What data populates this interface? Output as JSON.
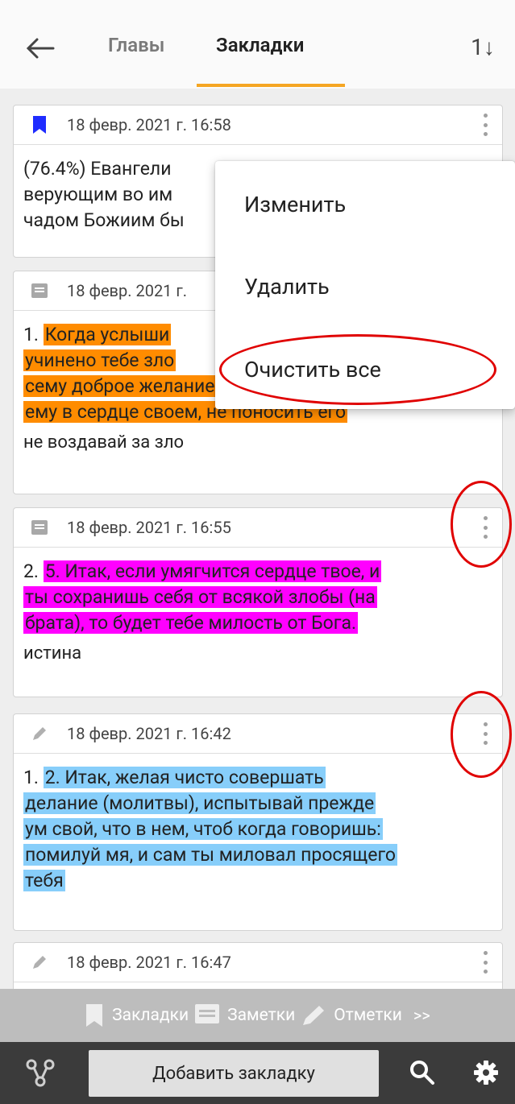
{
  "topbar": {
    "back_icon": "arrow-left-icon",
    "tabs": [
      {
        "label": "Главы",
        "active": false
      },
      {
        "label": "Закладки",
        "active": true
      }
    ],
    "sort_label": "1↓",
    "accent": "#f5a623"
  },
  "cards": [
    {
      "icon": "bookmark-icon",
      "icon_color": "#1f2cff",
      "date": "18 февр. 2021 г. 16:58",
      "text_lines": [
        "(76.4%) Евангели",
        "верующим во им",
        "чадом Божиим бы"
      ]
    },
    {
      "icon": "note-icon",
      "date": "18 февр. 2021 г.",
      "highlight_color": "#ff8c00",
      "prefix": "1. ",
      "highlight_lines": [
        "Когда услыши",
        "учинено тебе зло",
        "сему доброе желание о нем",
        "ему в сердце своем, не поносить его"
      ],
      "note": "не воздавай за зло"
    },
    {
      "icon": "note-icon",
      "date": "18 февр. 2021 г. 16:55",
      "highlight_color": "#ff00ff",
      "prefix": "2. ",
      "highlight_lines": [
        "5. Итак, если умягчится сердце твое, и",
        "ты сохранишь себя от всякой злобы (на",
        "брата), то будет тебе милость от Бога."
      ],
      "note": "истина"
    },
    {
      "icon": "pencil-icon",
      "date": "18 февр. 2021 г. 16:42",
      "highlight_color": "#87cefa",
      "prefix": "1. ",
      "highlight_lines": [
        "2. Итак, желая чисто совершать",
        "делание (молитвы), испытывай прежде",
        "ум свой, что в нем, чтоб когда говоришь:",
        "помилуй мя, и сам ты миловал просящего",
        "тебя"
      ]
    },
    {
      "icon": "pencil-icon",
      "date": "18 февр. 2021 г. 16:47"
    }
  ],
  "context_menu": {
    "items": [
      "Изменить",
      "Удалить",
      "Очистить все"
    ]
  },
  "filter_bar": {
    "items": [
      {
        "label": "Закладки",
        "icon": "bookmark-icon"
      },
      {
        "label": "Заметки",
        "icon": "note-icon"
      },
      {
        "label": "Отметки",
        "icon": "pencil-icon"
      }
    ],
    "more": ">>"
  },
  "bottom_bar": {
    "add_button": "Добавить закладку",
    "left_icon": "share-nodes-icon",
    "search_icon": "search-icon",
    "settings_icon": "gear-icon"
  },
  "colors": {
    "annotation": "#e00000"
  }
}
